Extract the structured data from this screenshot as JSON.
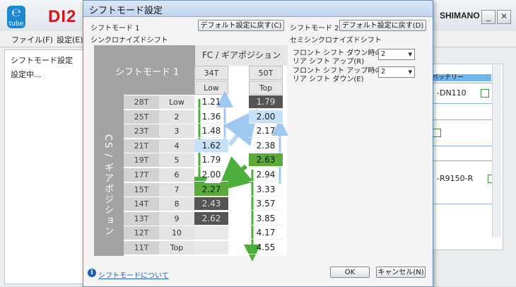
{
  "app": {
    "logo_text": "tube",
    "name": "DI2",
    "brand": "SHIMANO",
    "menu": [
      "ファイル(F)",
      "設定(E)"
    ],
    "left_panel": [
      "シフトモード設定",
      "設定中..."
    ],
    "right_panel": {
      "battery_label": "バッテリー",
      "item1": "-DN110",
      "item2": "-R9150-R"
    }
  },
  "dialog": {
    "title": "シフトモード設定",
    "mode1_label": "シフトモード 1",
    "mode1_sub": "シンクロナイズドシフト",
    "default_button_1": "デフォルト設定に戻す(C)",
    "mode2_label": "シフトモード 2",
    "default_button_2": "デフォルト設定に戻す(D)",
    "mode2_sub": "セミシンクロナイズドシフト",
    "option1_label": [
      "フロント シフト ダウン時の",
      "リア シフト アップ(R)"
    ],
    "option1_value": "2",
    "option2_label": [
      "フロント シフト アップ時の",
      "リア シフト ダウン(E)"
    ],
    "option2_value": "2",
    "help_link": "シフトモードについて",
    "ok_button": "OK",
    "cancel_button": "キャンセル(N)"
  },
  "table": {
    "shift_mode_header": "シフトモード 1",
    "fc_header": "FC / ギアポジション",
    "cs_header": "CS / ギアポジション",
    "col34": {
      "teeth": "34T",
      "pos": "Low"
    },
    "col50": {
      "teeth": "50T",
      "pos": "Top"
    },
    "rows": [
      {
        "cog": "28T",
        "pos": "Low",
        "v34": "1.21",
        "v50": "1.79"
      },
      {
        "cog": "25T",
        "pos": "2",
        "v34": "1.36",
        "v50": "2.00"
      },
      {
        "cog": "23T",
        "pos": "3",
        "v34": "1.48",
        "v50": "2.17"
      },
      {
        "cog": "21T",
        "pos": "4",
        "v34": "1.62",
        "v50": "2.38"
      },
      {
        "cog": "19T",
        "pos": "5",
        "v34": "1.79",
        "v50": "2.63"
      },
      {
        "cog": "17T",
        "pos": "6",
        "v34": "2.00",
        "v50": "2.94"
      },
      {
        "cog": "15T",
        "pos": "7",
        "v34": "2.27",
        "v50": "3.33"
      },
      {
        "cog": "14T",
        "pos": "8",
        "v34": "2.43",
        "v50": "3.57"
      },
      {
        "cog": "13T",
        "pos": "9",
        "v34": "2.62",
        "v50": "3.85"
      },
      {
        "cog": "12T",
        "pos": "10",
        "v34": "",
        "v50": "4.17"
      },
      {
        "cog": "11T",
        "pos": "Top",
        "v34": "",
        "v50": "4.55"
      }
    ],
    "colors": {
      "highlight_blue": "#c5e0f7",
      "highlight_green": "#5aaa3c",
      "dark": "#555555",
      "disabled": "#e8e8e8"
    }
  }
}
